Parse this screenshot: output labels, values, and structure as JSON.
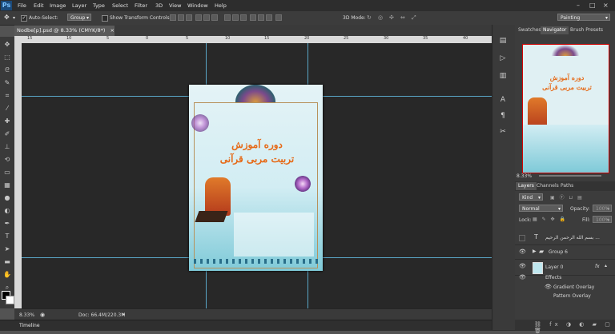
{
  "app": {
    "logo": "Ps"
  },
  "menu": [
    "File",
    "Edit",
    "Image",
    "Layer",
    "Type",
    "Select",
    "Filter",
    "3D",
    "View",
    "Window",
    "Help"
  ],
  "window_controls": [
    "–",
    "□",
    "×"
  ],
  "options_bar": {
    "auto_select_label": "Auto-Select:",
    "auto_select_checked": "✓",
    "auto_select_target": "Group",
    "transform_label": "Show Transform Controls",
    "mode_3d_label": "3D Mode:",
    "workspace": "Painting"
  },
  "document_tab": {
    "title": "Nodbe[p].psd @ 8.33% (CMYK/8*)",
    "close": "×"
  },
  "ruler": {
    "h_ticks": [
      "15",
      "10",
      "5",
      "0",
      "5",
      "10",
      "15",
      "20",
      "25",
      "30",
      "35",
      "40"
    ]
  },
  "status": {
    "zoom": "8.33%",
    "doc": "Doc: 66.4M/220.3M"
  },
  "timeline_label": "Timeline",
  "poster": {
    "title_line1": "دوره آموزش",
    "title_line2": "تربیت مربی قرآنی"
  },
  "top_panel": {
    "tabs": [
      "Swatches",
      "Navigator",
      "Brush Presets"
    ],
    "active_tab": "Navigator",
    "zoom": "8.33%"
  },
  "layers_panel": {
    "tabs": [
      "Layers",
      "Channels",
      "Paths"
    ],
    "active_tab": "Layers",
    "kind": "Kind",
    "blend_mode": "Normal",
    "opacity_label": "Opacity:",
    "opacity": "100%",
    "lock_label": "Lock:",
    "fill_label": "Fill:",
    "fill": "100%",
    "layers": [
      {
        "name": "بسم الله الرحمن الرحیم ...",
        "type": "T"
      },
      {
        "name": "Group 6",
        "type": "folder"
      },
      {
        "name": "Layer 0",
        "type": "image",
        "fx": "fx"
      }
    ],
    "effects_label": "Effects",
    "effects": [
      "Gradient Overlay",
      "Pattern Overlay"
    ]
  },
  "colors": {
    "accent": "#5aa6c7",
    "canvas": "#282828",
    "panel": "#3c3c3c"
  }
}
